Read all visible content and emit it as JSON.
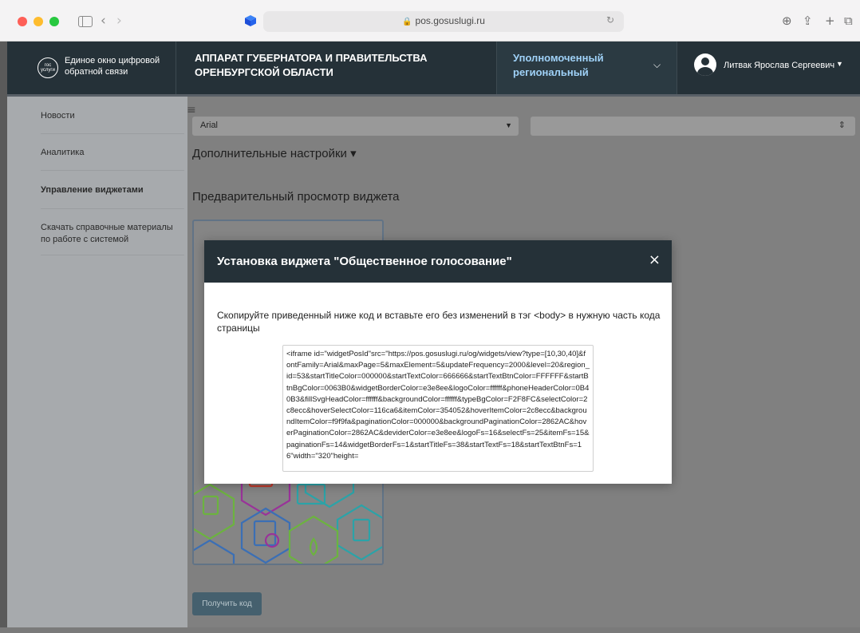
{
  "browser": {
    "url": "pos.gosuslugi.ru"
  },
  "header": {
    "logo_badge": "гос услуги",
    "logo_text": "Единое окно цифровой обратной связи",
    "org_title": "АППАРАТ ГУБЕРНАТОРА И ПРАВИТЕЛЬСТВА ОРЕНБУРГСКОЙ ОБЛАСТИ",
    "role": "Уполномоченный региональный",
    "user_name": "Литвак Ярослав Сергеевич"
  },
  "sidebar": {
    "items": [
      {
        "label": "Новости"
      },
      {
        "label": "Аналитика"
      },
      {
        "label": "Управление виджетами",
        "active": true
      },
      {
        "label": "Скачать справочные материалы по работе с системой"
      }
    ]
  },
  "main": {
    "font_value": "Arial",
    "extra_settings": "Дополнительные настройки ▾",
    "preview_title": "Предварительный просмотр виджета",
    "get_code_label": "Получить код"
  },
  "modal": {
    "title": "Установка виджета \"Общественное голосование\"",
    "instruction": "Скопируйте приведенный ниже код и вставьте его без изменений в тэг <body> в нужную часть кода страницы",
    "code": "<iframe id=\"widgetPosId\"src=\"https://pos.gosuslugi.ru/og/widgets/view?type=[10,30,40]&fontFamily=Arial&maxPage=5&maxElement=5&updateFrequency=2000&level=20&region_id=53&startTitleColor=000000&startTextColor=666666&startTextBtnColor=FFFFFF&startBtnBgColor=0063B0&widgetBorderColor=e3e8ee&logoColor=ffffff&phoneHeaderColor=0B40B3&fillSvgHeadColor=ffffff&backgroundColor=ffffff&typeBgColor=F2F8FC&selectColor=2c8ecc&hoverSelectColor=116ca6&itemColor=354052&hoverItemColor=2c8ecc&backgroundItemColor=f9f9fa&paginationColor=000000&backgroundPaginationColor=2862AC&hoverPaginationColor=2862AC&deviderColor=e3e8ee&logoFs=16&selectFs=25&itemFs=15&paginationFs=14&widgetBorderFs=1&startTitleFs=38&startTextFs=18&startTextBtnFs=16\"width=\"320\"height=",
    "close_symbol": "×"
  },
  "colors": {
    "header_bg": "#253138",
    "role_text": "#9fd1f7",
    "overlay_main": "#808080",
    "overlay_nav": "#a7aaad"
  }
}
